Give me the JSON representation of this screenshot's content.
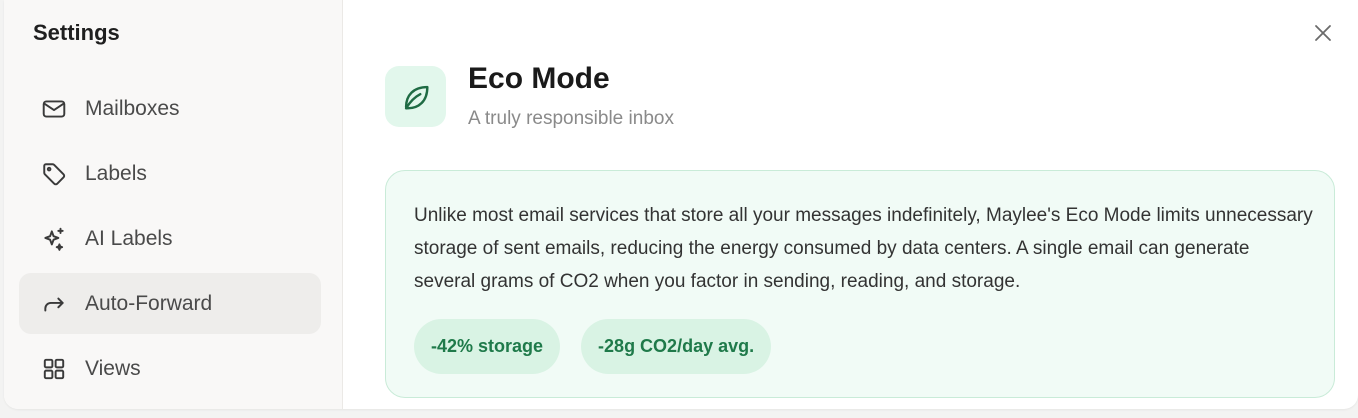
{
  "sidebar": {
    "title": "Settings",
    "items": [
      {
        "label": "Mailboxes",
        "icon": "mail-icon",
        "active": false
      },
      {
        "label": "Labels",
        "icon": "tag-icon",
        "active": false
      },
      {
        "label": "AI Labels",
        "icon": "sparkles-icon",
        "active": false
      },
      {
        "label": "Auto-Forward",
        "icon": "forward-arrow-icon",
        "active": true
      },
      {
        "label": "Views",
        "icon": "grid-icon",
        "active": false
      }
    ]
  },
  "main": {
    "title": "Eco Mode",
    "subtitle": "A truly responsible inbox",
    "header_icon": "leaf-icon",
    "description": "Unlike most email services that store all your messages indefinitely, Maylee's Eco Mode limits unnecessary storage of sent emails, reducing the energy consumed by data centers. A single email can generate several grams of CO2 when you factor in sending, reading, and storage.",
    "badges": [
      "-42% storage",
      "-28g CO2/day avg."
    ]
  },
  "colors": {
    "accent_green": "#1f7a4a",
    "card_bg": "#f1fbf6",
    "card_border": "#c9ebd8",
    "badge_bg": "#d9f3e4",
    "active_item_bg": "#eeedeb"
  }
}
